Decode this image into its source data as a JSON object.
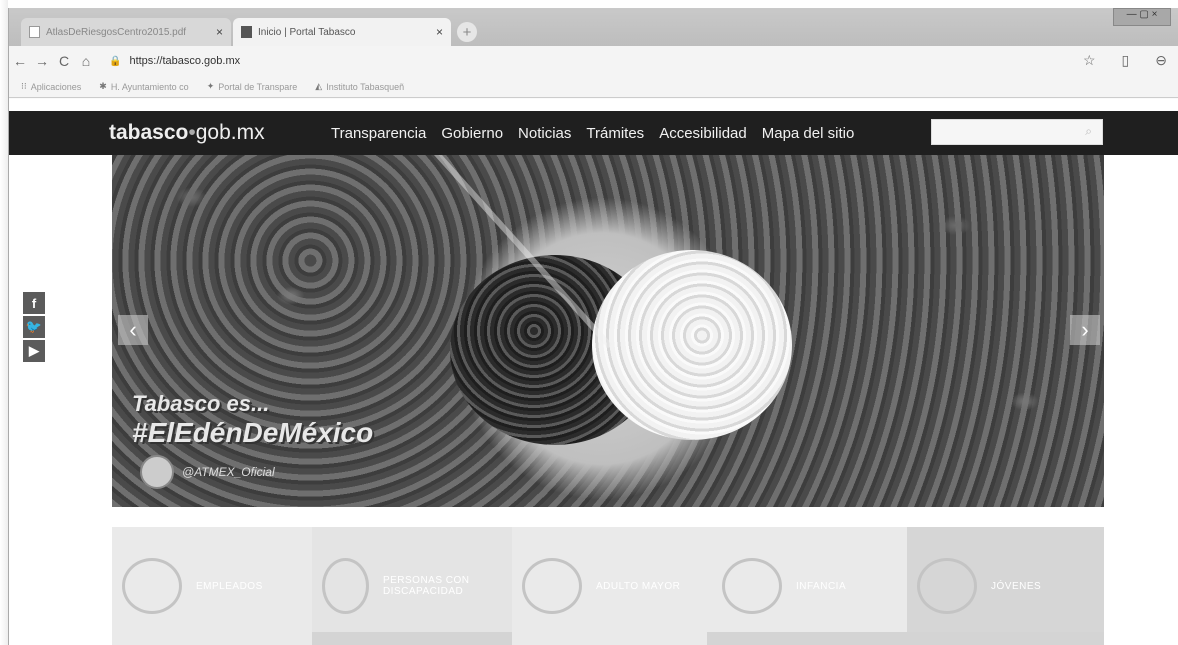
{
  "tabs": [
    {
      "label": "AtlasDeRiesgosCentro2015.pdf",
      "close": "×"
    },
    {
      "label": "Inicio | Portal Tabasco",
      "close": "×"
    }
  ],
  "newtab": "+",
  "address": {
    "url": "https://tabasco.gob.mx",
    "back": "←",
    "forward": "→",
    "reload": "C",
    "home": "⌂",
    "star": "☆",
    "ext": "▯",
    "profile": "⊖"
  },
  "bookmarks": [
    {
      "icon": "apps-icon",
      "label": "Aplicaciones"
    },
    {
      "icon": "bookmark-icon",
      "label": "H. Ayuntamiento co"
    },
    {
      "icon": "bookmark-icon",
      "label": "Portal de Transpare"
    },
    {
      "icon": "bookmark-icon",
      "label": "Instituto Tabasqueñ"
    }
  ],
  "site": {
    "logo_bold": "tabasco",
    "logo_dot": "•",
    "logo_rest": "gob.mx",
    "menu": [
      "Transparencia",
      "Gobierno",
      "Noticias",
      "Trámites",
      "Accesibilidad",
      "Mapa del sitio"
    ],
    "search_icon": "⌕"
  },
  "hero": {
    "line1": "Tabasco es...",
    "line2": "#ElEdénDeMéxico",
    "handle": "@ATMEX_Oficial",
    "prev": "‹",
    "next": "›"
  },
  "social": [
    "f",
    "🐦",
    "▶"
  ],
  "categories": [
    {
      "label": "EMPLEADOS"
    },
    {
      "label": "PERSONAS CON DISCAPACIDAD"
    },
    {
      "label": "ADULTO MAYOR"
    },
    {
      "label": "INFANCIA"
    },
    {
      "label": "JÓVENES"
    }
  ]
}
